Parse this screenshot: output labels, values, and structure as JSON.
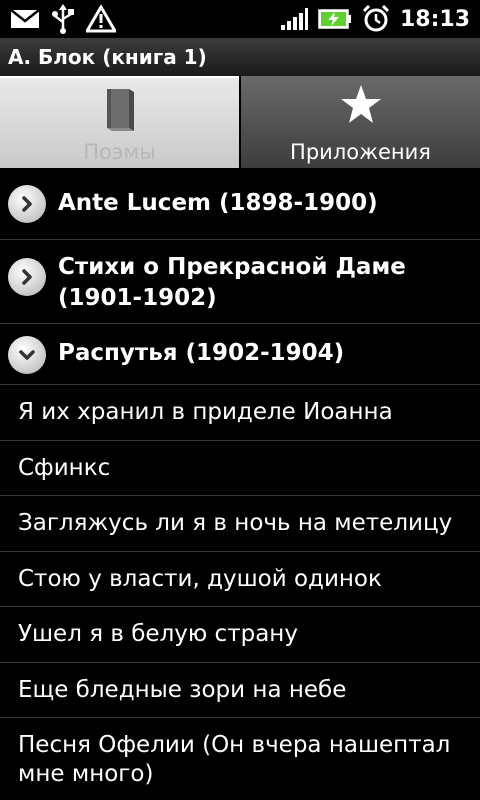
{
  "status_bar": {
    "time": "18:13",
    "left_icons": [
      "mail-icon",
      "usb-icon",
      "warning-icon"
    ],
    "right_icons": [
      "signal-icon",
      "battery-charging-icon",
      "alarm-clock-icon"
    ]
  },
  "title_bar": {
    "title": "А. Блок (книга 1)"
  },
  "tabs": [
    {
      "label": "Поэмы",
      "icon": "book-icon",
      "active": true
    },
    {
      "label": "Приложения",
      "icon": "star-icon",
      "active": false
    }
  ],
  "groups": [
    {
      "label": "Ante Lucem (1898-1900)",
      "expanded": false
    },
    {
      "label": "Стихи о Прекрасной Даме (1901-1902)",
      "expanded": false
    },
    {
      "label": "Распутья (1902-1904)",
      "expanded": true
    }
  ],
  "items": [
    {
      "label": "Я их хранил в приделе Иоанна"
    },
    {
      "label": "Сфинкс"
    },
    {
      "label": "Загляжусь ли я в ночь на метелицу"
    },
    {
      "label": "Стою у власти, душой одинок"
    },
    {
      "label": "Ушел я в белую страну"
    },
    {
      "label": "Еще бледные зори на небе"
    },
    {
      "label": "Песня Офелии (Он вчера нашептал мне много)"
    }
  ]
}
